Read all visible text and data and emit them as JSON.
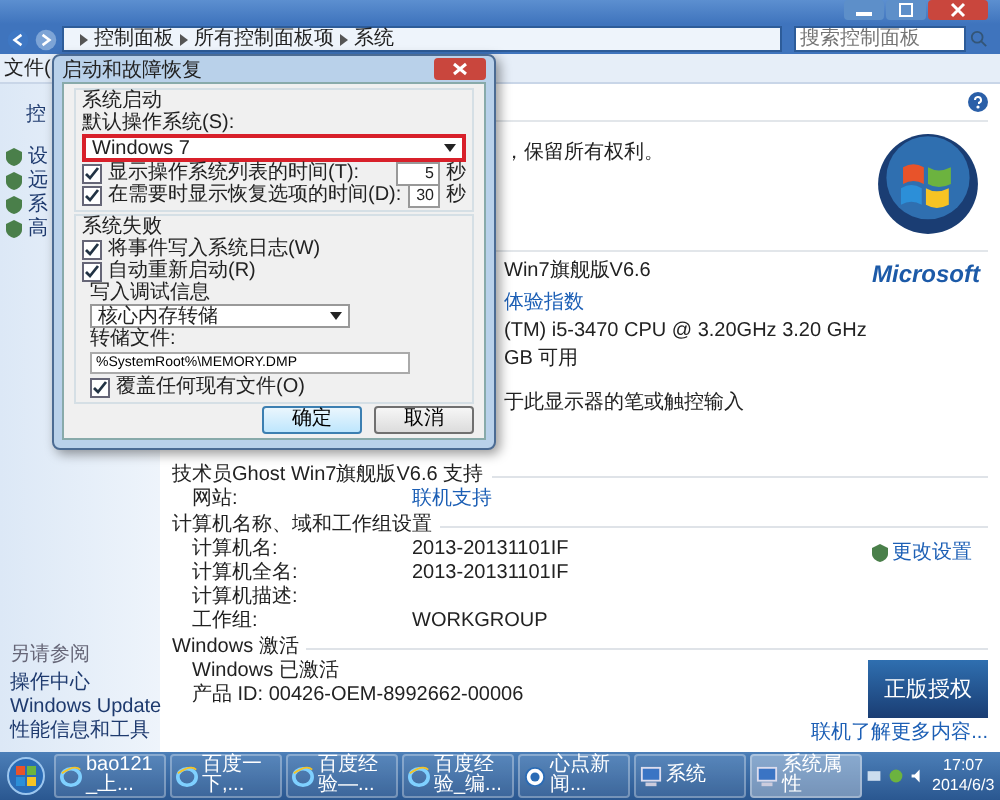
{
  "address_bar": {
    "path": [
      "控制面板",
      "所有控制面板项",
      "系统"
    ],
    "search": {
      "placeholder": "搜索控制面板"
    }
  },
  "menu_bar": [
    "文件("
  ],
  "sidebar": {
    "header": "控",
    "items": [
      "设",
      "远",
      "系",
      "高"
    ],
    "see_also": {
      "title": "另请参阅",
      "links": [
        "操作中心",
        "Windows Update",
        "性能信息和工具"
      ]
    }
  },
  "main": {
    "copyright": "，保留所有权利。",
    "system_lines": [
      {
        "text": "Win7旗舰版V6.6",
        "kind": "text"
      },
      {
        "text": "体验指数",
        "kind": "link"
      },
      {
        "text": "(TM) i5-3470 CPU @ 3.20GHz   3.20 GHz",
        "kind": "text"
      },
      {
        "text": "GB 可用",
        "kind": "text"
      },
      {
        "text": "于此显示器的笔或触控输入",
        "kind": "text"
      }
    ],
    "brand": "Microsoft",
    "sections": [
      {
        "title": "技术员Ghost Win7旗舰版V6.6 支持",
        "rows": [
          {
            "label": "网站:",
            "value": "联机支持",
            "kind": "link"
          }
        ]
      },
      {
        "title": "计算机名称、域和工作组设置",
        "action": "更改设置",
        "rows": [
          {
            "label": "计算机名:",
            "value": "2013-20131101IF",
            "kind": "text"
          },
          {
            "label": "计算机全名:",
            "value": "2013-20131101IF",
            "kind": "text"
          },
          {
            "label": "计算机描述:"
          },
          {
            "label": "工作组:",
            "value": "WORKGROUP",
            "kind": "text"
          }
        ]
      },
      {
        "title": "Windows 激活",
        "rows": [
          {
            "label": "Windows 已激活"
          },
          {
            "label": "产品 ID: 00426-OEM-8992662-00006"
          }
        ],
        "badge": {
          "text": "正版授权",
          "link": "联机了解更多内容..."
        }
      }
    ]
  },
  "dialog": {
    "title": "启动和故障恢复",
    "startup": {
      "title": "系统启动",
      "default_label": "默认操作系统(S):",
      "default_os": "Windows 7",
      "highlighted": true,
      "timers": [
        {
          "label": "显示操作系统列表的时间(T):",
          "checked": true,
          "value": "5",
          "unit": "秒"
        },
        {
          "label": "在需要时显示恢复选项的时间(D):",
          "checked": true,
          "value": "30",
          "unit": "秒"
        }
      ]
    },
    "failure": {
      "title": "系统失败",
      "options": [
        {
          "label": "将事件写入系统日志(W)",
          "checked": true
        },
        {
          "label": "自动重新启动(R)",
          "checked": true
        }
      ],
      "debug_label": "写入调试信息",
      "debug_type": "核心内存转储",
      "dump_label": "转储文件:",
      "dump_file": "%SystemRoot%\\MEMORY.DMP",
      "overwrite": {
        "label": "覆盖任何现有文件(O)",
        "checked": true
      }
    },
    "buttons": [
      {
        "label": "确定",
        "default": true
      },
      {
        "label": "取消",
        "default": false
      }
    ]
  },
  "taskbar": {
    "items": [
      {
        "label": "bao121_上...",
        "kind": "browser",
        "selected": false
      },
      {
        "label": "百度一下,...",
        "kind": "browser",
        "selected": false
      },
      {
        "label": "百度经验—...",
        "kind": "browser",
        "selected": false
      },
      {
        "label": "百度经验_编...",
        "kind": "browser",
        "selected": false
      },
      {
        "label": "心点新闻...",
        "kind": "player",
        "selected": false
      },
      {
        "label": "系统",
        "kind": "computer",
        "selected": false
      },
      {
        "label": "系统属性",
        "kind": "computer",
        "selected": true
      }
    ],
    "time": "17:07",
    "date": "2014/6/3"
  }
}
